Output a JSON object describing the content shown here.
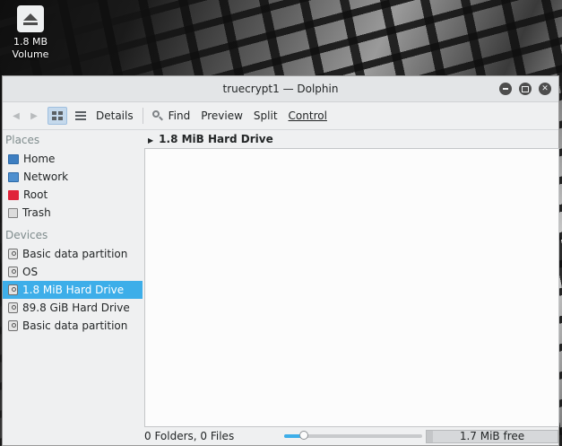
{
  "desktop": {
    "icon_name": "eject-icon",
    "icon_label_line1": "1.8 MB",
    "icon_label_line2": "Volume"
  },
  "window": {
    "title": "truecrypt1 — Dolphin",
    "buttons": [
      "minimize",
      "maximize",
      "close"
    ]
  },
  "toolbar": {
    "back_icon": "back-arrow-icon",
    "forward_icon": "forward-arrow-icon",
    "icons_view_icon": "icons-view-icon",
    "details_view_icon": "details-view-icon",
    "details_label": "Details",
    "find_label": "Find",
    "preview_label": "Preview",
    "split_label": "Split",
    "control_label": "Control"
  },
  "places": {
    "section_places": "Places",
    "items": [
      {
        "label": "Home",
        "icon": "home-folder-icon"
      },
      {
        "label": "Network",
        "icon": "network-folder-icon"
      },
      {
        "label": "Root",
        "icon": "root-folder-icon"
      },
      {
        "label": "Trash",
        "icon": "trash-icon"
      }
    ],
    "section_devices": "Devices",
    "devices": [
      {
        "label": "Basic data partition",
        "icon": "hard-drive-icon"
      },
      {
        "label": "OS",
        "icon": "hard-drive-icon"
      },
      {
        "label": "1.8 MiB Hard Drive",
        "icon": "hard-drive-icon",
        "selected": true
      },
      {
        "label": "89.8 GiB Hard Drive",
        "icon": "hard-drive-icon"
      },
      {
        "label": "Basic data partition",
        "icon": "hard-drive-icon"
      }
    ]
  },
  "content": {
    "breadcrumb": "1.8 MiB Hard Drive"
  },
  "status": {
    "summary": "0 Folders, 0 Files",
    "zoom_fraction": 0.14,
    "free_space": "1.7 MiB free",
    "free_used_fraction": 0.05
  },
  "colors": {
    "accent": "#3daee9",
    "window_bg": "#eff0f1",
    "view_bg": "#fcfcfc"
  }
}
